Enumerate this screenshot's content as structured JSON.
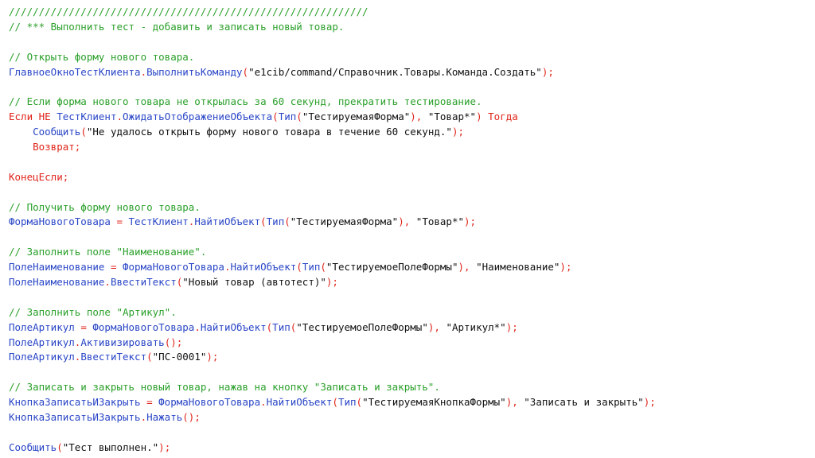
{
  "editor": {
    "lines": [
      [
        {
          "t": "comment",
          "v": "////////////////////////////////////////////////////////////"
        }
      ],
      [
        {
          "t": "comment",
          "v": "// *** Выполнить тест - добавить и записать новый товар."
        }
      ],
      [],
      [
        {
          "t": "comment",
          "v": "// Открыть форму нового товара."
        }
      ],
      [
        {
          "t": "ident",
          "v": "ГлавноеОкноТестКлиента"
        },
        {
          "t": "punct",
          "v": "."
        },
        {
          "t": "ident",
          "v": "ВыполнитьКоманду"
        },
        {
          "t": "punct",
          "v": "("
        },
        {
          "t": "string",
          "v": "\"e1cib/command/Справочник.Товары.Команда.Создать\""
        },
        {
          "t": "punct",
          "v": ");"
        }
      ],
      [],
      [
        {
          "t": "comment",
          "v": "// Если форма нового товара не открылась за 60 секунд, прекратить тестирование."
        }
      ],
      [
        {
          "t": "keyword",
          "v": "Если НЕ "
        },
        {
          "t": "ident",
          "v": "ТестКлиент"
        },
        {
          "t": "punct",
          "v": "."
        },
        {
          "t": "ident",
          "v": "ОжидатьОтображениеОбъекта"
        },
        {
          "t": "punct",
          "v": "("
        },
        {
          "t": "ident",
          "v": "Тип"
        },
        {
          "t": "punct",
          "v": "("
        },
        {
          "t": "string",
          "v": "\"ТестируемаяФорма\""
        },
        {
          "t": "punct",
          "v": "), "
        },
        {
          "t": "string",
          "v": "\"Товар*\""
        },
        {
          "t": "punct",
          "v": ") "
        },
        {
          "t": "keyword",
          "v": "Тогда"
        }
      ],
      [
        {
          "t": "plain",
          "v": "    "
        },
        {
          "t": "ident",
          "v": "Сообщить"
        },
        {
          "t": "punct",
          "v": "("
        },
        {
          "t": "string",
          "v": "\"Не удалось открыть форму нового товара в течение 60 секунд.\""
        },
        {
          "t": "punct",
          "v": ");"
        }
      ],
      [
        {
          "t": "plain",
          "v": "    "
        },
        {
          "t": "keyword",
          "v": "Возврат;"
        }
      ],
      [],
      [
        {
          "t": "keyword",
          "v": "КонецЕсли;"
        }
      ],
      [],
      [
        {
          "t": "comment",
          "v": "// Получить форму нового товара."
        }
      ],
      [
        {
          "t": "ident",
          "v": "ФормаНовогоТовара"
        },
        {
          "t": "punct",
          "v": " = "
        },
        {
          "t": "ident",
          "v": "ТестКлиент"
        },
        {
          "t": "punct",
          "v": "."
        },
        {
          "t": "ident",
          "v": "НайтиОбъект"
        },
        {
          "t": "punct",
          "v": "("
        },
        {
          "t": "ident",
          "v": "Тип"
        },
        {
          "t": "punct",
          "v": "("
        },
        {
          "t": "string",
          "v": "\"ТестируемаяФорма\""
        },
        {
          "t": "punct",
          "v": "), "
        },
        {
          "t": "string",
          "v": "\"Товар*\""
        },
        {
          "t": "punct",
          "v": ");"
        }
      ],
      [],
      [
        {
          "t": "comment",
          "v": "// Заполнить поле \"Наименование\"."
        }
      ],
      [
        {
          "t": "ident",
          "v": "ПолеНаименование"
        },
        {
          "t": "punct",
          "v": " = "
        },
        {
          "t": "ident",
          "v": "ФормаНовогоТовара"
        },
        {
          "t": "punct",
          "v": "."
        },
        {
          "t": "ident",
          "v": "НайтиОбъект"
        },
        {
          "t": "punct",
          "v": "("
        },
        {
          "t": "ident",
          "v": "Тип"
        },
        {
          "t": "punct",
          "v": "("
        },
        {
          "t": "string",
          "v": "\"ТестируемоеПолеФормы\""
        },
        {
          "t": "punct",
          "v": "), "
        },
        {
          "t": "string",
          "v": "\"Наименование\""
        },
        {
          "t": "punct",
          "v": ");"
        }
      ],
      [
        {
          "t": "ident",
          "v": "ПолеНаименование"
        },
        {
          "t": "punct",
          "v": "."
        },
        {
          "t": "ident",
          "v": "ВвестиТекст"
        },
        {
          "t": "punct",
          "v": "("
        },
        {
          "t": "string",
          "v": "\"Новый товар (автотест)\""
        },
        {
          "t": "punct",
          "v": ");"
        }
      ],
      [],
      [
        {
          "t": "comment",
          "v": "// Заполнить поле \"Артикул\"."
        }
      ],
      [
        {
          "t": "ident",
          "v": "ПолеАртикул"
        },
        {
          "t": "punct",
          "v": " = "
        },
        {
          "t": "ident",
          "v": "ФормаНовогоТовара"
        },
        {
          "t": "punct",
          "v": "."
        },
        {
          "t": "ident",
          "v": "НайтиОбъект"
        },
        {
          "t": "punct",
          "v": "("
        },
        {
          "t": "ident",
          "v": "Тип"
        },
        {
          "t": "punct",
          "v": "("
        },
        {
          "t": "string",
          "v": "\"ТестируемоеПолеФормы\""
        },
        {
          "t": "punct",
          "v": "), "
        },
        {
          "t": "string",
          "v": "\"Артикул*\""
        },
        {
          "t": "punct",
          "v": ");"
        }
      ],
      [
        {
          "t": "ident",
          "v": "ПолеАртикул"
        },
        {
          "t": "punct",
          "v": "."
        },
        {
          "t": "ident",
          "v": "Активизировать"
        },
        {
          "t": "punct",
          "v": "();"
        }
      ],
      [
        {
          "t": "ident",
          "v": "ПолеАртикул"
        },
        {
          "t": "punct",
          "v": "."
        },
        {
          "t": "ident",
          "v": "ВвестиТекст"
        },
        {
          "t": "punct",
          "v": "("
        },
        {
          "t": "string",
          "v": "\"ПС-0001\""
        },
        {
          "t": "punct",
          "v": ");"
        }
      ],
      [],
      [
        {
          "t": "comment",
          "v": "// Записать и закрыть новый товар, нажав на кнопку \"Записать и закрыть\"."
        }
      ],
      [
        {
          "t": "ident",
          "v": "КнопкаЗаписатьИЗакрыть"
        },
        {
          "t": "punct",
          "v": " = "
        },
        {
          "t": "ident",
          "v": "ФормаНовогоТовара"
        },
        {
          "t": "punct",
          "v": "."
        },
        {
          "t": "ident",
          "v": "НайтиОбъект"
        },
        {
          "t": "punct",
          "v": "("
        },
        {
          "t": "ident",
          "v": "Тип"
        },
        {
          "t": "punct",
          "v": "("
        },
        {
          "t": "string",
          "v": "\"ТестируемаяКнопкаФормы\""
        },
        {
          "t": "punct",
          "v": "), "
        },
        {
          "t": "string",
          "v": "\"Записать и закрыть\""
        },
        {
          "t": "punct",
          "v": ");"
        }
      ],
      [
        {
          "t": "ident",
          "v": "КнопкаЗаписатьИЗакрыть"
        },
        {
          "t": "punct",
          "v": "."
        },
        {
          "t": "ident",
          "v": "Нажать"
        },
        {
          "t": "punct",
          "v": "();"
        }
      ],
      [],
      [
        {
          "t": "ident",
          "v": "Сообщить"
        },
        {
          "t": "punct",
          "v": "("
        },
        {
          "t": "string",
          "v": "\"Тест выполнен.\""
        },
        {
          "t": "punct",
          "v": ");"
        }
      ]
    ]
  }
}
